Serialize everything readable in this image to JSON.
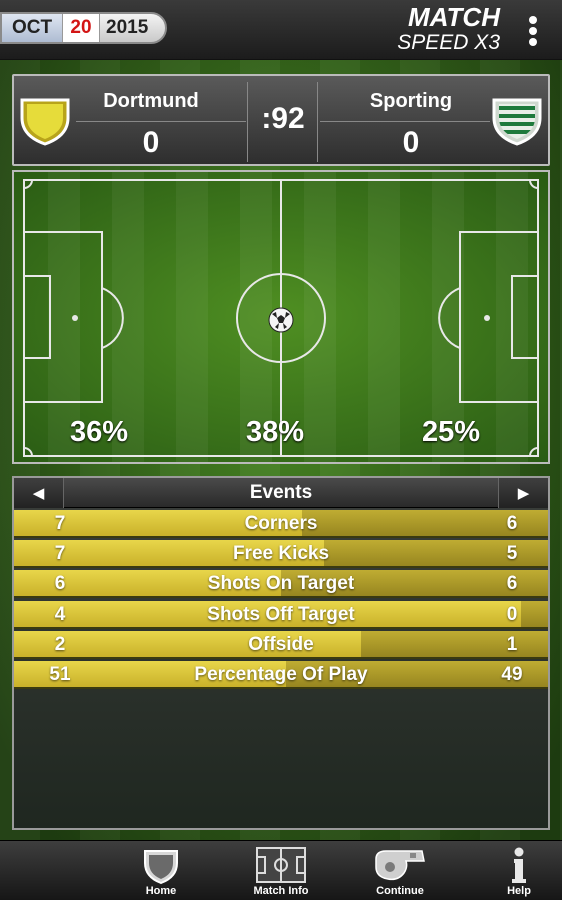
{
  "header": {
    "date": {
      "month": "OCT",
      "day": "20",
      "year": "2015"
    },
    "title": "MATCH",
    "speed": "SPEED X3"
  },
  "scoreboard": {
    "home": {
      "name": "Dortmund",
      "score": "0",
      "crest_color": "#e3d423"
    },
    "away": {
      "name": "Sporting",
      "score": "0",
      "crest_color": "#1e7a3c"
    },
    "clock": ":92"
  },
  "pitch": {
    "possession": {
      "left": "36%",
      "center": "38%",
      "right": "25%"
    }
  },
  "events": {
    "title": "Events",
    "prev_icon": "triangle-left-icon",
    "next_icon": "triangle-right-icon",
    "rows": [
      {
        "label": "Corners",
        "home": "7",
        "away": "6",
        "away_share": 0.46
      },
      {
        "label": "Free Kicks",
        "home": "7",
        "away": "5",
        "away_share": 0.42
      },
      {
        "label": "Shots On Target",
        "home": "6",
        "away": "6",
        "away_share": 0.5
      },
      {
        "label": "Shots Off Target",
        "home": "4",
        "away": "0",
        "away_share": 0.05
      },
      {
        "label": "Offside",
        "home": "2",
        "away": "1",
        "away_share": 0.35
      },
      {
        "label": "Percentage Of Play",
        "home": "51",
        "away": "49",
        "away_share": 0.49
      }
    ]
  },
  "bottom_nav": {
    "home": "Home",
    "match_info": "Match Info",
    "continue": "Continue",
    "help": "Help"
  }
}
